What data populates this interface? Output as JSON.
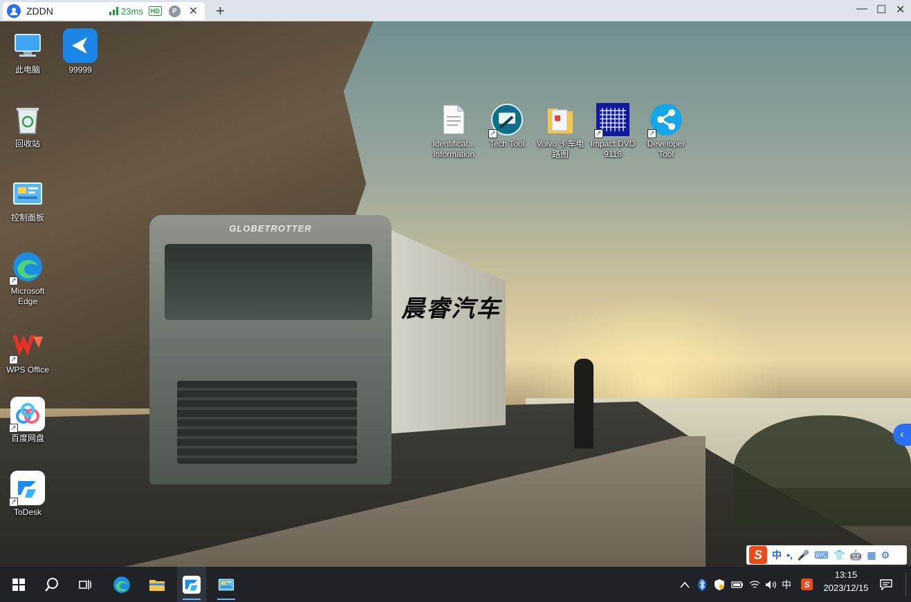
{
  "client": {
    "tab_title": "ZDDN",
    "latency": "23ms",
    "hd_badge": "HD",
    "p_badge": "P",
    "close_glyph": "✕",
    "newtab_glyph": "+",
    "minimize_glyph": "—",
    "maximize_glyph": "☐",
    "close_window_glyph": "✕"
  },
  "desktop": {
    "watermark": "晨睿汽车",
    "wallpaper_brand": "GLOBETROTTER",
    "icons": [
      {
        "label": "此电脑",
        "icon": "computer-icon"
      },
      {
        "label": "99999",
        "icon": "app-99999-icon"
      },
      {
        "label": "回收站",
        "icon": "recycle-bin-icon"
      },
      {
        "label": "控制面板",
        "icon": "control-panel-icon"
      },
      {
        "label": "Microsoft Edge",
        "icon": "edge-icon"
      },
      {
        "label": "WPS Office",
        "icon": "wps-icon"
      },
      {
        "label": "百度网盘",
        "icon": "baidu-netdisk-icon"
      },
      {
        "label": "ToDesk",
        "icon": "todesk-icon"
      },
      {
        "label": "Identificat... Information",
        "icon": "document-icon"
      },
      {
        "label": "Tech Tool",
        "icon": "tech-tool-icon"
      },
      {
        "label": "Volvo 卡车电路图",
        "icon": "folder-icon"
      },
      {
        "label": "Impact DVD 9116",
        "icon": "impact-dvd-icon"
      },
      {
        "label": "Developer Tool",
        "icon": "developer-tool-icon"
      }
    ],
    "side_tab_glyph": "‹"
  },
  "ime_bar": {
    "logo": "S",
    "items": [
      "中",
      "•,",
      "🎤",
      "⌨",
      "👕",
      "🤖",
      "▦",
      "⚙"
    ]
  },
  "taskbar": {
    "tray_ime": "中",
    "time": "13:15",
    "date": "2023/12/15"
  },
  "colors": {
    "accent": "#2a6ff0",
    "latency_green": "#1c9d3a",
    "taskbar_bg": "#1f2328",
    "sogou_orange": "#ec4a1b"
  }
}
